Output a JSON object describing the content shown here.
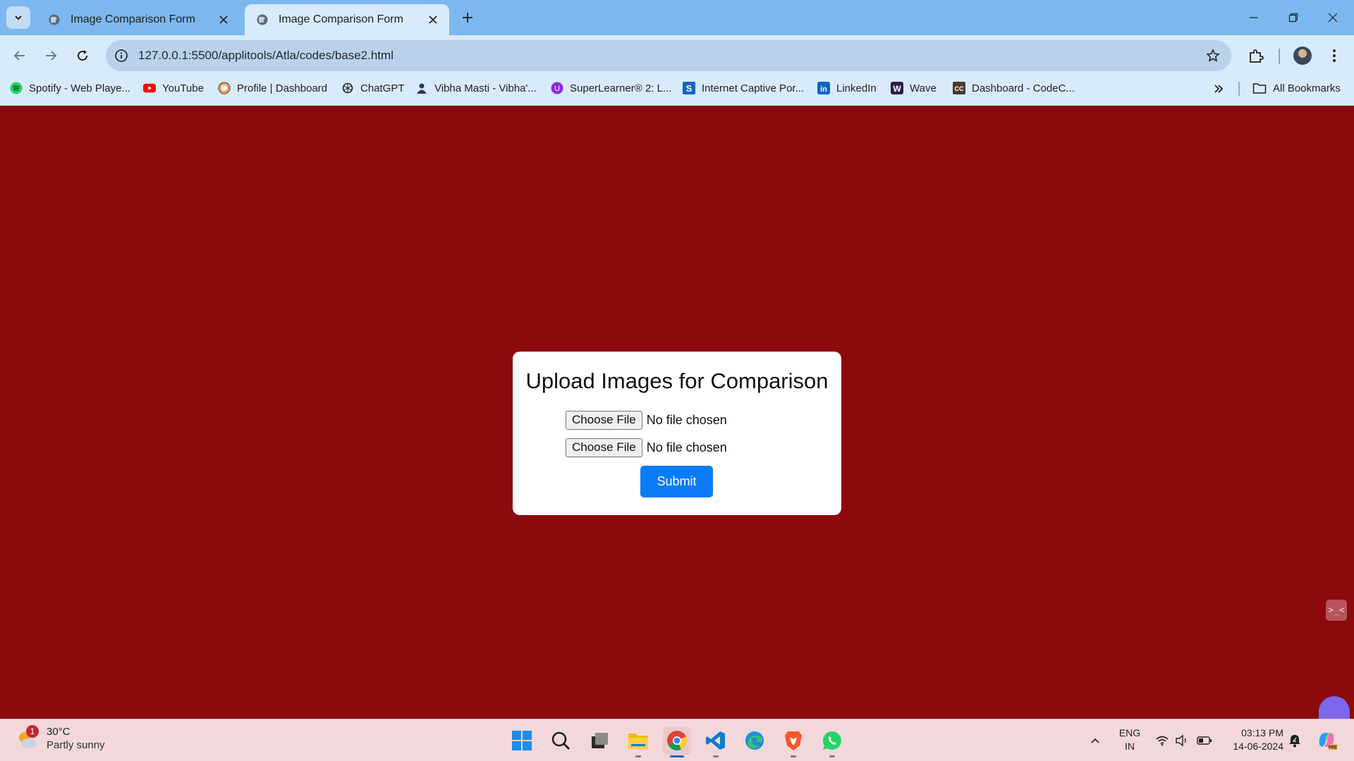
{
  "browser": {
    "tabs": [
      {
        "title": "Image Comparison Form",
        "active": false
      },
      {
        "title": "Image Comparison Form",
        "active": true
      }
    ],
    "url": "127.0.0.1:5500/applitools/Atla/codes/base2.html",
    "bookmarks": [
      {
        "label": "Spotify - Web Playe...",
        "icon": "spotify-icon"
      },
      {
        "label": "YouTube",
        "icon": "youtube-icon"
      },
      {
        "label": "Profile | Dashboard",
        "icon": "profile-icon"
      },
      {
        "label": "ChatGPT",
        "icon": "chatgpt-icon"
      },
      {
        "label": "Vibha Masti - Vibha'...",
        "icon": "vibha-icon"
      },
      {
        "label": "SuperLearner® 2: L...",
        "icon": "superlearner-icon"
      },
      {
        "label": "Internet Captive Por...",
        "icon": "captive-portal-icon"
      },
      {
        "label": "LinkedIn",
        "icon": "linkedin-icon"
      },
      {
        "label": "Wave",
        "icon": "wave-icon"
      },
      {
        "label": "Dashboard - CodeC...",
        "icon": "codechef-icon"
      }
    ],
    "all_bookmarks": "All Bookmarks"
  },
  "page": {
    "background": "#8b0a0c",
    "heading": "Upload Images for Comparison",
    "file_inputs": [
      {
        "button": "Choose File",
        "status": "No file chosen"
      },
      {
        "button": "Choose File",
        "status": "No file chosen"
      }
    ],
    "submit_label": "Submit",
    "accent": "#0a7cf8"
  },
  "taskbar": {
    "weather": {
      "badge": "1",
      "temperature": "30°C",
      "condition": "Partly sunny"
    },
    "apps": [
      "start-icon",
      "search-icon",
      "task-view-icon",
      "file-explorer-icon",
      "chrome-icon",
      "vscode-icon",
      "edge-icon",
      "brave-icon",
      "whatsapp-icon"
    ],
    "language": {
      "line1": "ENG",
      "line2": "IN"
    },
    "time": "03:13 PM",
    "date": "14-06-2024"
  }
}
